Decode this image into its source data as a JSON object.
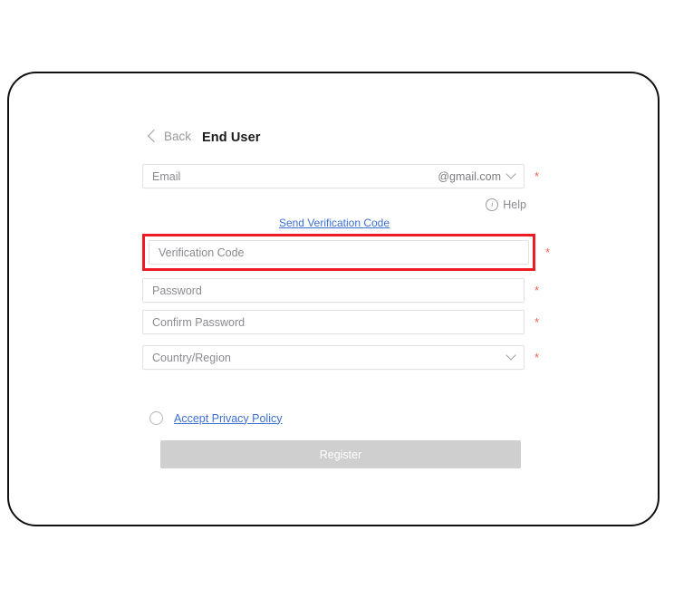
{
  "header": {
    "back_label": "Back",
    "title": "End User"
  },
  "form": {
    "email": {
      "placeholder": "Email",
      "domain_suffix": "@gmail.com",
      "required_marker": "*"
    },
    "help": {
      "label": "Help"
    },
    "send_verification_code": {
      "label": "Send Verification Code"
    },
    "verification_code": {
      "placeholder": "Verification Code",
      "required_marker": "*"
    },
    "password": {
      "placeholder": "Password",
      "required_marker": "*"
    },
    "confirm_password": {
      "placeholder": "Confirm Password",
      "required_marker": "*"
    },
    "country_region": {
      "placeholder": "Country/Region",
      "required_marker": "*"
    },
    "privacy_policy": {
      "label": "Accept Privacy Policy",
      "checked": false
    },
    "register_button": {
      "label": "Register",
      "enabled": false
    }
  },
  "colors": {
    "link_blue": "#3b6fd4",
    "required_red": "#f4624f",
    "highlight_red": "#ed1c24",
    "button_disabled_gray": "#cfcfcf",
    "frame_black": "#111111"
  }
}
